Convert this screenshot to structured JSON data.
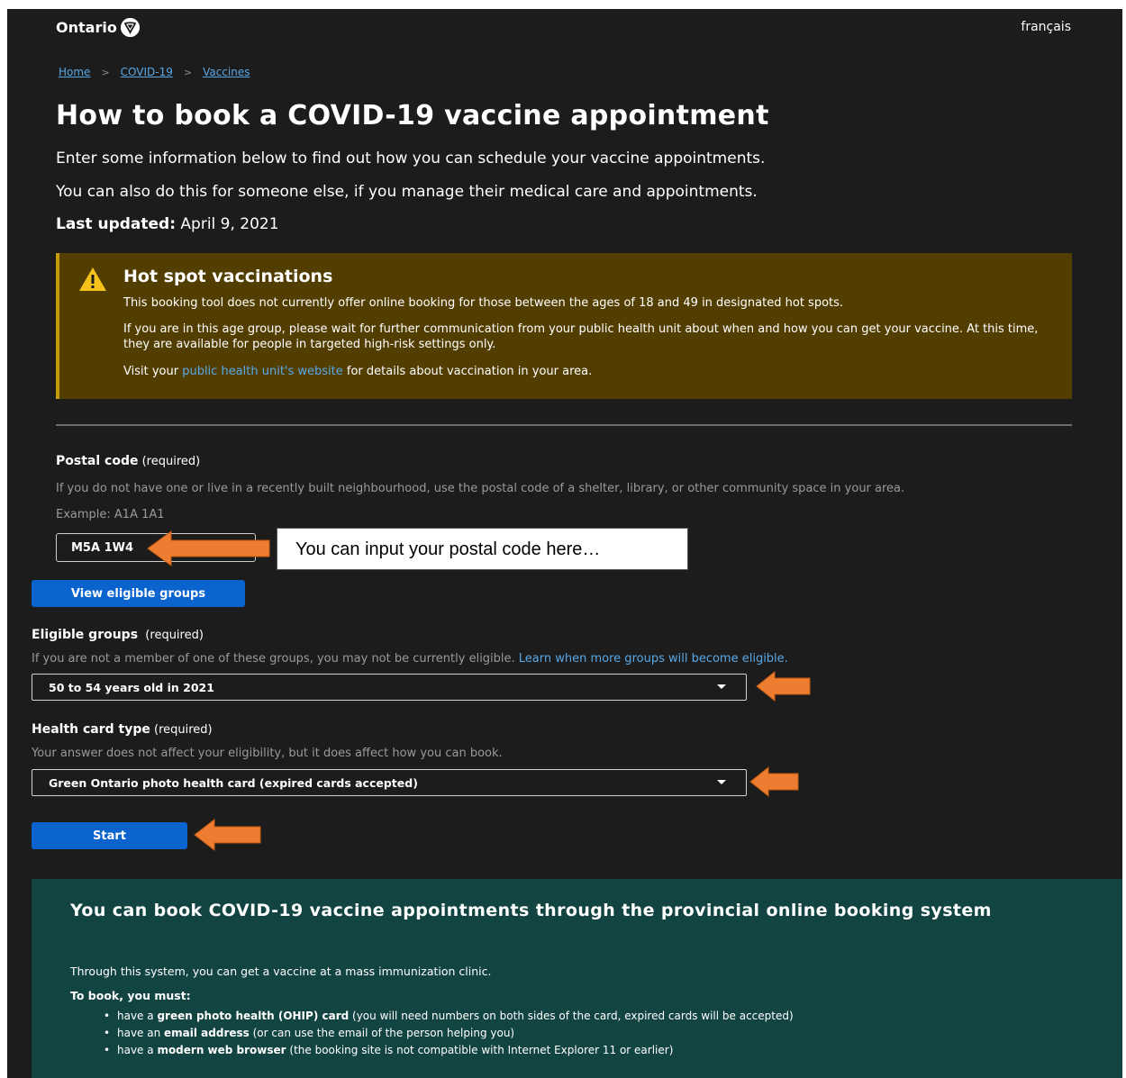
{
  "header": {
    "logo_text": "Ontario",
    "language_link": "français"
  },
  "breadcrumb": [
    "Home",
    "COVID-19",
    "Vaccines"
  ],
  "page": {
    "title": "How to book a COVID-19 vaccine appointment",
    "intro_1": "Enter some information below to find out how you can schedule your vaccine appointments.",
    "intro_2": "You can also do this for someone else, if you manage their medical care and appointments.",
    "updated_label": "Last updated:",
    "updated_date": " April 9, 2021"
  },
  "callout": {
    "title": "Hot spot vaccinations",
    "p1": "This booking tool does not currently offer online booking for those between the ages of 18 and 49 in designated hot spots.",
    "p2": "If you are in this age group, please wait for further communication from your public health unit about when and how you can get your vaccine. At this time, they are available for people in targeted high-risk settings only.",
    "p3_before": "Visit your ",
    "p3_link": "public health unit's website",
    "p3_after": " for details about vaccination in your area.",
    "accent_color": "#533e02"
  },
  "postal": {
    "label": "Postal code",
    "required": " (required)",
    "hint": "If you do not have one or live in a recently built neighbourhood, use the postal code of a shelter, library, or other community space in your area.",
    "example": "Example: A1A 1A1",
    "value": "M5A 1W4"
  },
  "annotation": {
    "tooltip": "You can input your postal code here…",
    "arrow_color": "#ed7d31"
  },
  "buttons": {
    "view_eligible": "View eligible groups",
    "start": "Start",
    "color": "#0b63ce"
  },
  "eligible": {
    "label": "Eligible groups",
    "required": "  (required)",
    "hint_before": "If you are not a member of one of these groups, you may not be currently eligible. ",
    "hint_link": "Learn when more groups will become eligible.",
    "selected": "50 to 54 years old in 2021"
  },
  "health_card": {
    "label": "Health card type",
    "required": " (required)",
    "hint": "Your answer does not affect your eligibility, but it does affect how you can book.",
    "selected": "Green Ontario photo health card (expired cards accepted)"
  },
  "booking": {
    "title": "You can book COVID-19 vaccine appointments through the provincial online booking system",
    "p1": "Through this system, you can get a vaccine at a mass immunization clinic.",
    "p2": "To book, you must:",
    "items": [
      {
        "pre": "have a ",
        "bold": "green photo health (OHIP) card",
        "post": " (you will need numbers on both sides of the card, expired cards will be accepted)"
      },
      {
        "pre": "have an ",
        "bold": "email address",
        "post": " (or can use the email of the person helping you)"
      },
      {
        "pre": "have a ",
        "bold": "modern web browser",
        "post": " (the booking site is not compatible with Internet Explorer 11 or earlier)"
      }
    ],
    "bg_color": "#124442"
  }
}
